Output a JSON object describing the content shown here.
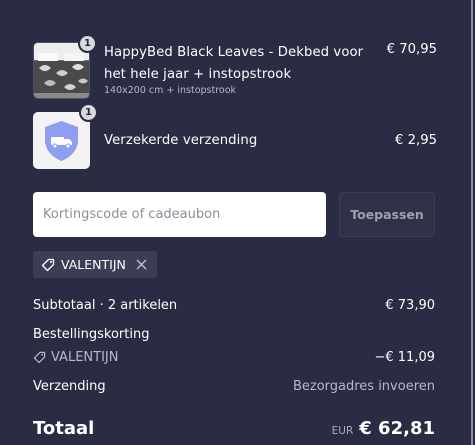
{
  "items": [
    {
      "quantity": "1",
      "title": "HappyBed Black Leaves - Dekbed voor het hele jaar + instopstrook",
      "subtitle": "140x200 cm + instopstrook",
      "price": "€ 70,95",
      "thumbnail": "duvet-product-image"
    },
    {
      "quantity": "1",
      "title": "Verzekerde verzending",
      "price": "€ 2,95",
      "thumbnail": "shield-truck-icon"
    }
  ],
  "discount": {
    "input_placeholder": "Kortingscode of cadeaubon",
    "apply_label": "Toepassen",
    "applied_code": "VALENTIJN"
  },
  "summary": {
    "subtotal_label": "Subtotaal · 2 artikelen",
    "subtotal_value": "€ 73,90",
    "order_discount_label": "Bestellingskorting",
    "discount_code": "VALENTIJN",
    "discount_value": "−€ 11,09",
    "shipping_label": "Verzending",
    "shipping_value": "Bezorgadres invoeren",
    "total_label": "Totaal",
    "currency": "EUR",
    "total_value": "€ 62,81"
  },
  "colors": {
    "background": "#292c42",
    "accent_shield": "#8f9ef0"
  }
}
